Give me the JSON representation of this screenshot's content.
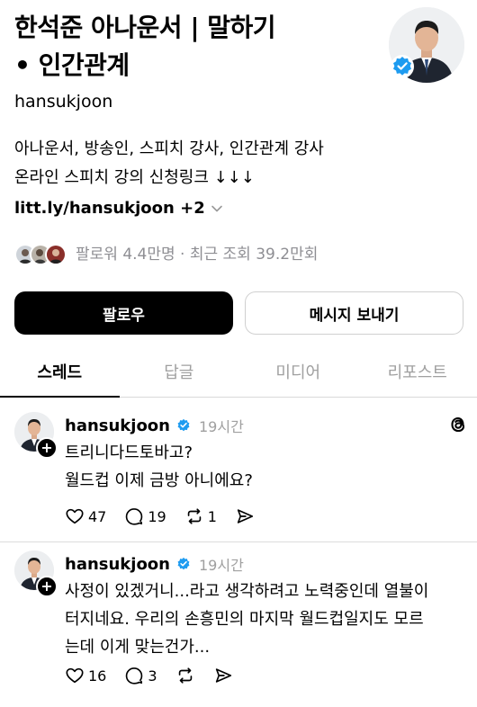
{
  "profile": {
    "title_line1": "한석준 아나운서 | 말하기",
    "title_line2": "• 인간관계",
    "handle": "hansukjoon",
    "bio_line1": "아나운서, 방송인, 스피치 강사, 인간관계 강사",
    "bio_line2": "온라인 스피치 강의 신청링크 ↓↓↓",
    "link": "litt.ly/hansukjoon +2",
    "followers_text": "팔로워 4.4만명 · 최근 조회 39.2만회"
  },
  "buttons": {
    "follow": "팔로우",
    "message": "메시지 보내기"
  },
  "tabs": [
    {
      "label": "스레드",
      "active": true
    },
    {
      "label": "답글",
      "active": false
    },
    {
      "label": "미디어",
      "active": false
    },
    {
      "label": "리포스트",
      "active": false
    }
  ],
  "posts": [
    {
      "handle": "hansukjoon",
      "time": "19시간",
      "text_lines": [
        "트리니다드토바고?",
        "월드컵 이제 금방 아니에요?"
      ],
      "likes": "47",
      "comments": "19",
      "reposts": "1"
    },
    {
      "handle": "hansukjoon",
      "time": "19시간",
      "text_lines": [
        "사정이 있겠거니...라고 생각하려고 노력중인데 열불이",
        "터지네요. 우리의 손흥민의 마지막 월드컵일지도 모르",
        "는데 이게 맞는건가..."
      ],
      "likes": "16",
      "comments": "3"
    }
  ],
  "colors": {
    "verified": "#1d9bf0",
    "muted": "#8e8e93",
    "primary_button": "#000000"
  },
  "icons": [
    "verified-icon",
    "chevron-down-icon",
    "plus-icon",
    "threads-logo-icon",
    "heart-icon",
    "comment-icon",
    "repost-icon",
    "share-icon"
  ]
}
